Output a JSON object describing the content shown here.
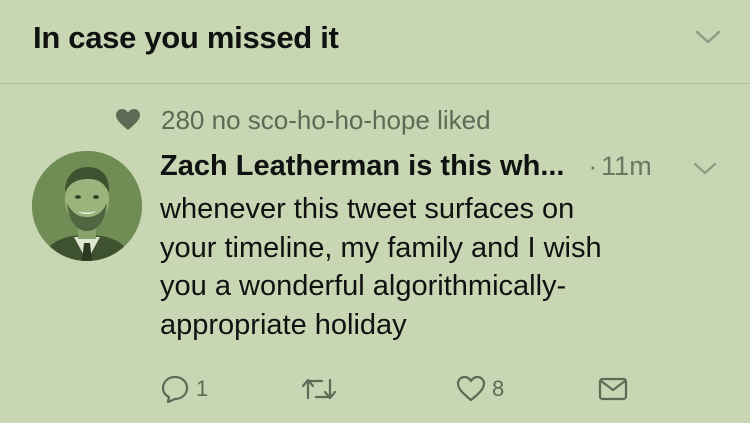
{
  "header": {
    "title": "In case you missed it",
    "chevron_icon": "chevron-down-icon"
  },
  "social_context": {
    "icon": "heart-icon",
    "text": "280 no sco-ho-ho-hope liked"
  },
  "tweet": {
    "author_name": "Zach Leatherman is this wh...",
    "separator": "·",
    "time": "11m",
    "body_lines": [
      "whenever this tweet surfaces on",
      "your timeline, my family and I wish",
      "you a wonderful algorithmically-",
      "appropriate holiday"
    ],
    "actions": {
      "reply_count": "1",
      "retweet_count": "",
      "like_count": "8"
    }
  },
  "colors": {
    "background": "#c8d6b4",
    "text": "#111111",
    "secondary_text": "#5e6a56",
    "divider": "#b3c0a1"
  }
}
